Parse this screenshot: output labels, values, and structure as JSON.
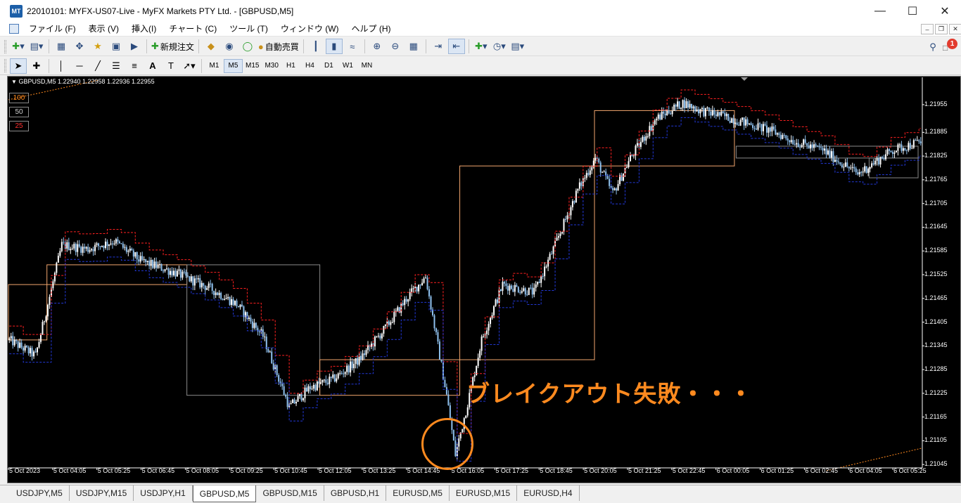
{
  "window": {
    "title": "22010101: MYFX-US07-Live - MyFX Markets PTY Ltd. - [GBPUSD,M5]",
    "logo": "MT"
  },
  "menu": [
    "ファイル (F)",
    "表示 (V)",
    "挿入(I)",
    "チャート (C)",
    "ツール (T)",
    "ウィンドウ (W)",
    "ヘルプ (H)"
  ],
  "toolbar": {
    "new_order": "新規注文",
    "autotrade": "自動売買",
    "alert_count": "1"
  },
  "draw_tools": {
    "text_tool": "A",
    "label_tool": "T"
  },
  "timeframes": [
    "M1",
    "M5",
    "M15",
    "M30",
    "H1",
    "H4",
    "D1",
    "W1",
    "MN"
  ],
  "active_timeframe": "M5",
  "chart": {
    "header": "GBPUSD,M5  1.22940 1.22958 1.22936 1.22955",
    "levels": [
      {
        "label": "100",
        "color": "#ff8a1f"
      },
      {
        "label": "50",
        "color": "#cfcfcf"
      },
      {
        "label": "25",
        "color": "#ff3030"
      }
    ],
    "callout": "ブレイクアウト失敗・・・",
    "colors": {
      "bull_candle": "#ffffff",
      "bear_candle": "#8fc1ef",
      "orange_box": "#f2a66e",
      "gray_box": "#8a8a8a",
      "red_dash": "#ff2020",
      "blue_dash": "#2238d8",
      "accent": "#ff8a1f"
    }
  },
  "chart_data": {
    "type": "candlestick",
    "symbol": "GBPUSD",
    "timeframe": "M5",
    "y_ticks": [
      "1.21955",
      "1.21885",
      "1.21825",
      "1.21765",
      "1.21705",
      "1.21645",
      "1.21585",
      "1.21525",
      "1.21465",
      "1.21405",
      "1.21345",
      "1.21285",
      "1.21225",
      "1.21165",
      "1.21105",
      "1.21045"
    ],
    "x_ticks": [
      "5 Oct 2023",
      "5 Oct 04:05",
      "5 Oct 05:25",
      "5 Oct 06:45",
      "5 Oct 08:05",
      "5 Oct 09:25",
      "5 Oct 10:45",
      "5 Oct 12:05",
      "5 Oct 13:25",
      "5 Oct 14:45",
      "5 Oct 16:05",
      "5 Oct 17:25",
      "5 Oct 18:45",
      "5 Oct 20:05",
      "5 Oct 21:25",
      "5 Oct 22:45",
      "6 Oct 00:05",
      "6 Oct 01:25",
      "6 Oct 02:45",
      "6 Oct 04:05",
      "6 Oct 05:25"
    ],
    "ylim": [
      1.2104,
      1.2201
    ],
    "anchor_closes": [
      [
        0,
        1.2136
      ],
      [
        15,
        1.2132
      ],
      [
        30,
        1.216
      ],
      [
        45,
        1.2159
      ],
      [
        60,
        1.2161
      ],
      [
        75,
        1.2156
      ],
      [
        95,
        1.2153
      ],
      [
        115,
        1.2149
      ],
      [
        130,
        1.2145
      ],
      [
        145,
        1.2137
      ],
      [
        160,
        1.2119
      ],
      [
        172,
        1.2124
      ],
      [
        185,
        1.2126
      ],
      [
        200,
        1.2131
      ],
      [
        215,
        1.2139
      ],
      [
        228,
        1.2147
      ],
      [
        238,
        1.2152
      ],
      [
        250,
        1.2122
      ],
      [
        255,
        1.2107
      ],
      [
        262,
        1.212
      ],
      [
        270,
        1.2136
      ],
      [
        282,
        1.215
      ],
      [
        300,
        1.2148
      ],
      [
        312,
        1.216
      ],
      [
        325,
        1.2174
      ],
      [
        335,
        1.2182
      ],
      [
        345,
        1.2173
      ],
      [
        355,
        1.2182
      ],
      [
        370,
        1.2192
      ],
      [
        385,
        1.2196
      ],
      [
        395,
        1.2194
      ],
      [
        405,
        1.2193
      ],
      [
        420,
        1.2191
      ],
      [
        435,
        1.2189
      ],
      [
        450,
        1.2186
      ],
      [
        465,
        1.2184
      ],
      [
        485,
        1.2178
      ],
      [
        505,
        1.2184
      ],
      [
        520,
        1.2186
      ]
    ],
    "boxes": [
      {
        "style": "orange",
        "x0": 0,
        "x1": 22,
        "top": 1.215,
        "bottom": 1.2136
      },
      {
        "style": "orange",
        "x0": 22,
        "x1": 102,
        "top": 1.2155,
        "bottom": 1.215
      },
      {
        "style": "gray",
        "x0": 102,
        "x1": 178,
        "top": 1.2155,
        "bottom": 1.2122
      },
      {
        "style": "orange",
        "x0": 178,
        "x1": 258,
        "top": 1.2131,
        "bottom": 1.2122
      },
      {
        "style": "orange",
        "x0": 258,
        "x1": 335,
        "top": 1.218,
        "bottom": 1.2131
      },
      {
        "style": "orange",
        "x0": 335,
        "x1": 415,
        "top": 1.2194,
        "bottom": 1.218
      },
      {
        "style": "gray",
        "x0": 416,
        "x1": 520,
        "top": 1.2185,
        "bottom": 1.2182
      },
      {
        "style": "gray",
        "x0": 492,
        "x1": 520,
        "top": 1.2182,
        "bottom": 1.2177
      }
    ]
  },
  "tabs": [
    "USDJPY,M5",
    "USDJPY,M15",
    "USDJPY,H1",
    "GBPUSD,M5",
    "GBPUSD,M15",
    "GBPUSD,H1",
    "EURUSD,M5",
    "EURUSD,M15",
    "EURUSD,H4"
  ],
  "active_tab": "GBPUSD,M5"
}
